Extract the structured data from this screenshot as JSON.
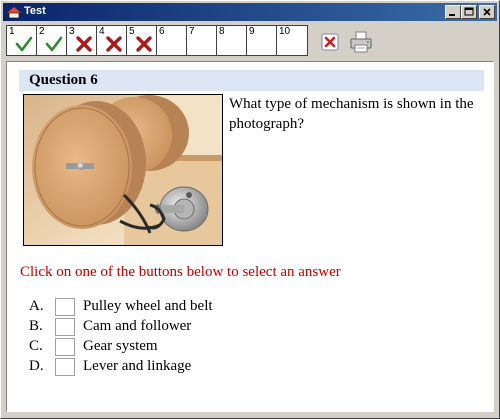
{
  "window": {
    "title": "Test"
  },
  "progress": [
    {
      "number": "1",
      "status": "correct"
    },
    {
      "number": "2",
      "status": "correct"
    },
    {
      "number": "3",
      "status": "incorrect"
    },
    {
      "number": "4",
      "status": "incorrect"
    },
    {
      "number": "5",
      "status": "incorrect"
    },
    {
      "number": "6",
      "status": "unanswered"
    },
    {
      "number": "7",
      "status": "unanswered"
    },
    {
      "number": "8",
      "status": "unanswered"
    },
    {
      "number": "9",
      "status": "unanswered"
    },
    {
      "number": "10",
      "status": "unanswered"
    }
  ],
  "toolbar": {
    "close_icon": "red-x-close-icon",
    "print_icon": "printer-icon"
  },
  "question": {
    "heading": "Question 6",
    "text": "What type of mechanism is shown in the photograph?",
    "instruction": "Click on one of the buttons below to select an answer",
    "options": [
      {
        "letter": "A.",
        "text": "Pulley wheel and belt"
      },
      {
        "letter": "B.",
        "text": "Cam and follower"
      },
      {
        "letter": "C.",
        "text": "Gear system"
      },
      {
        "letter": "D.",
        "text": "Lever and linkage"
      }
    ]
  },
  "colors": {
    "correct": "#2e8b2e",
    "incorrect": "#b01818",
    "instruction": "#c00000",
    "header_bg": "#dce6f2"
  }
}
